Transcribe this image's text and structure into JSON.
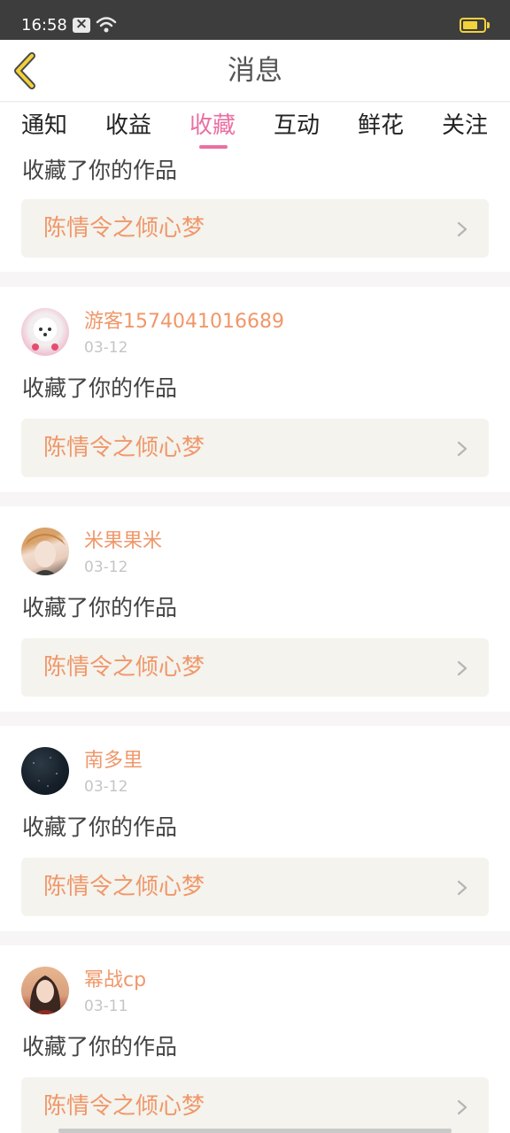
{
  "status_bar": {
    "time": "16:58",
    "battery_level": 0.6,
    "battery_color": "#f2d23a"
  },
  "header": {
    "title": "消息"
  },
  "tabs": [
    {
      "label": "通知",
      "active": false
    },
    {
      "label": "收益",
      "active": false
    },
    {
      "label": "收藏",
      "active": true
    },
    {
      "label": "互动",
      "active": false
    },
    {
      "label": "鲜花",
      "active": false
    },
    {
      "label": "关注",
      "active": false
    }
  ],
  "top_partial": {
    "action": "收藏了你的作品",
    "work_title": "陈情令之倾心梦"
  },
  "items": [
    {
      "user": "游客1574041016689",
      "date": "03-12",
      "action": "收藏了你的作品",
      "work_title": "陈情令之倾心梦",
      "avatar": "white-puppy-avatar"
    },
    {
      "user": "米果果米",
      "date": "03-12",
      "action": "收藏了你的作品",
      "work_title": "陈情令之倾心梦",
      "avatar": "person-portrait-avatar"
    },
    {
      "user": "南多里",
      "date": "03-12",
      "action": "收藏了你的作品",
      "work_title": "陈情令之倾心梦",
      "avatar": "dark-starry-avatar"
    },
    {
      "user": "幂战cp",
      "date": "03-11",
      "action": "收藏了你的作品",
      "work_title": "陈情令之倾心梦",
      "avatar": "woman-portrait-avatar"
    }
  ],
  "colors": {
    "accent": "#ea6fa3",
    "username": "#f0976a",
    "work_title": "#f0976a",
    "work_box_bg": "#f4f3ed"
  }
}
